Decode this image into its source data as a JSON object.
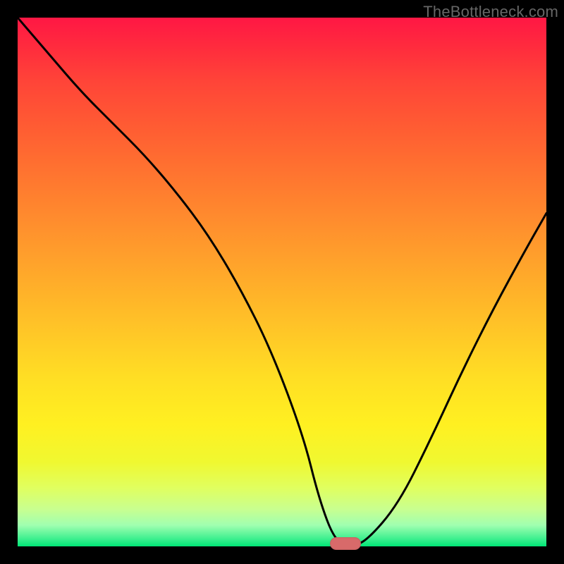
{
  "watermark": "TheBottleneck.com",
  "chart_data": {
    "type": "line",
    "title": "",
    "xlabel": "",
    "ylabel": "",
    "xlim": [
      0,
      100
    ],
    "ylim": [
      0,
      100
    ],
    "x": [
      0,
      6,
      12,
      18,
      24,
      30,
      36,
      42,
      48,
      54,
      57,
      60,
      63,
      66,
      72,
      78,
      84,
      90,
      96,
      100
    ],
    "values": [
      100,
      93,
      86,
      80,
      74,
      67,
      59,
      49,
      37,
      21,
      9,
      1,
      0,
      1,
      8,
      20,
      33,
      45,
      56,
      63
    ],
    "marker": {
      "x": 62,
      "y": 0
    },
    "background": {
      "type": "vertical-gradient",
      "stops": [
        {
          "pos": 0,
          "color": "#FF1744"
        },
        {
          "pos": 50,
          "color": "#FFB229"
        },
        {
          "pos": 80,
          "color": "#FFF021"
        },
        {
          "pos": 100,
          "color": "#00E676"
        }
      ]
    }
  }
}
